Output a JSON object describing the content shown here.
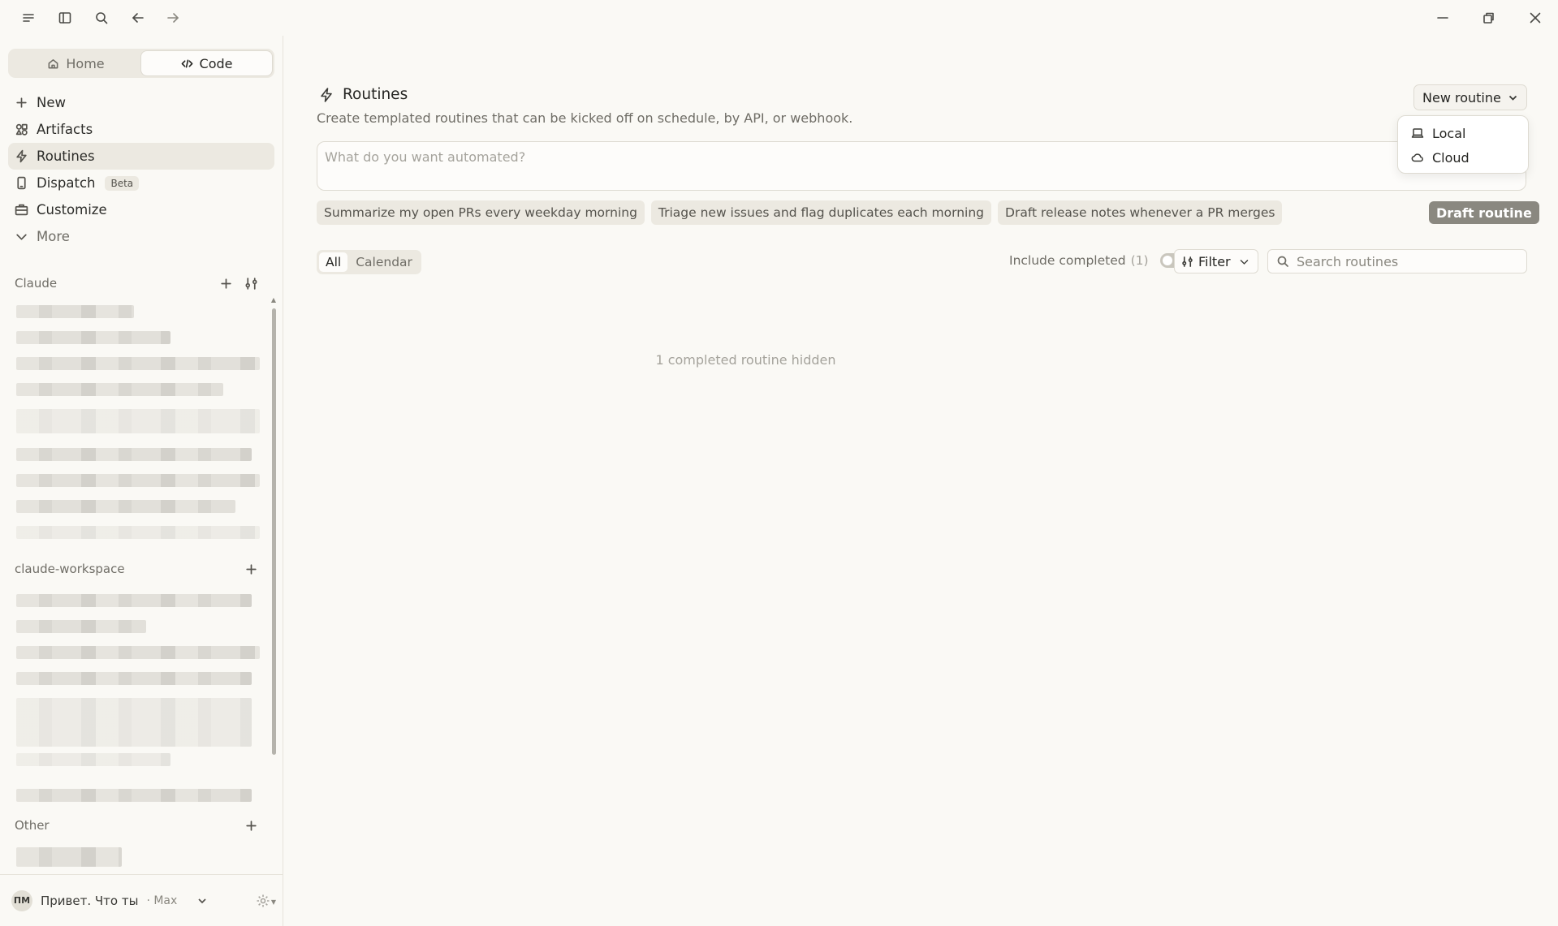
{
  "sidebar": {
    "segment": {
      "home_label": "Home",
      "code_label": "Code"
    },
    "nav": [
      {
        "label": "New"
      },
      {
        "label": "Artifacts"
      },
      {
        "label": "Routines"
      },
      {
        "label": "Dispatch",
        "badge": "Beta"
      },
      {
        "label": "Customize"
      },
      {
        "label": "More"
      }
    ],
    "sections": [
      {
        "title": "Claude"
      },
      {
        "title": "claude-workspace"
      },
      {
        "title": "Other"
      }
    ],
    "profile": {
      "initials": "ПМ",
      "name": "Привет. Что ты",
      "plan": "· Max"
    }
  },
  "main": {
    "title": "Routines",
    "description": "Create templated routines that can be kicked off on schedule, by API, or webhook.",
    "new_routine_label": "New routine",
    "dropdown": [
      {
        "label": "Local",
        "icon": "laptop-icon"
      },
      {
        "label": "Cloud",
        "icon": "cloud-icon"
      }
    ],
    "prompt_placeholder": "What do you want automated?",
    "suggestions": [
      "Summarize my open PRs every weekday morning",
      "Triage new issues and flag duplicates each morning",
      "Draft release notes whenever a PR merges"
    ],
    "draft_label": "Draft routine",
    "tabs": [
      {
        "label": "All"
      },
      {
        "label": "Calendar"
      }
    ],
    "include_completed_label": "Include completed",
    "include_completed_count": "(1)",
    "filter_label": "Filter",
    "search_placeholder": "Search routines",
    "empty_note": "1 completed routine hidden"
  },
  "colors": {
    "background": "#faf9f5",
    "draft_button": "#8a8880",
    "border": "#dedbd2"
  }
}
